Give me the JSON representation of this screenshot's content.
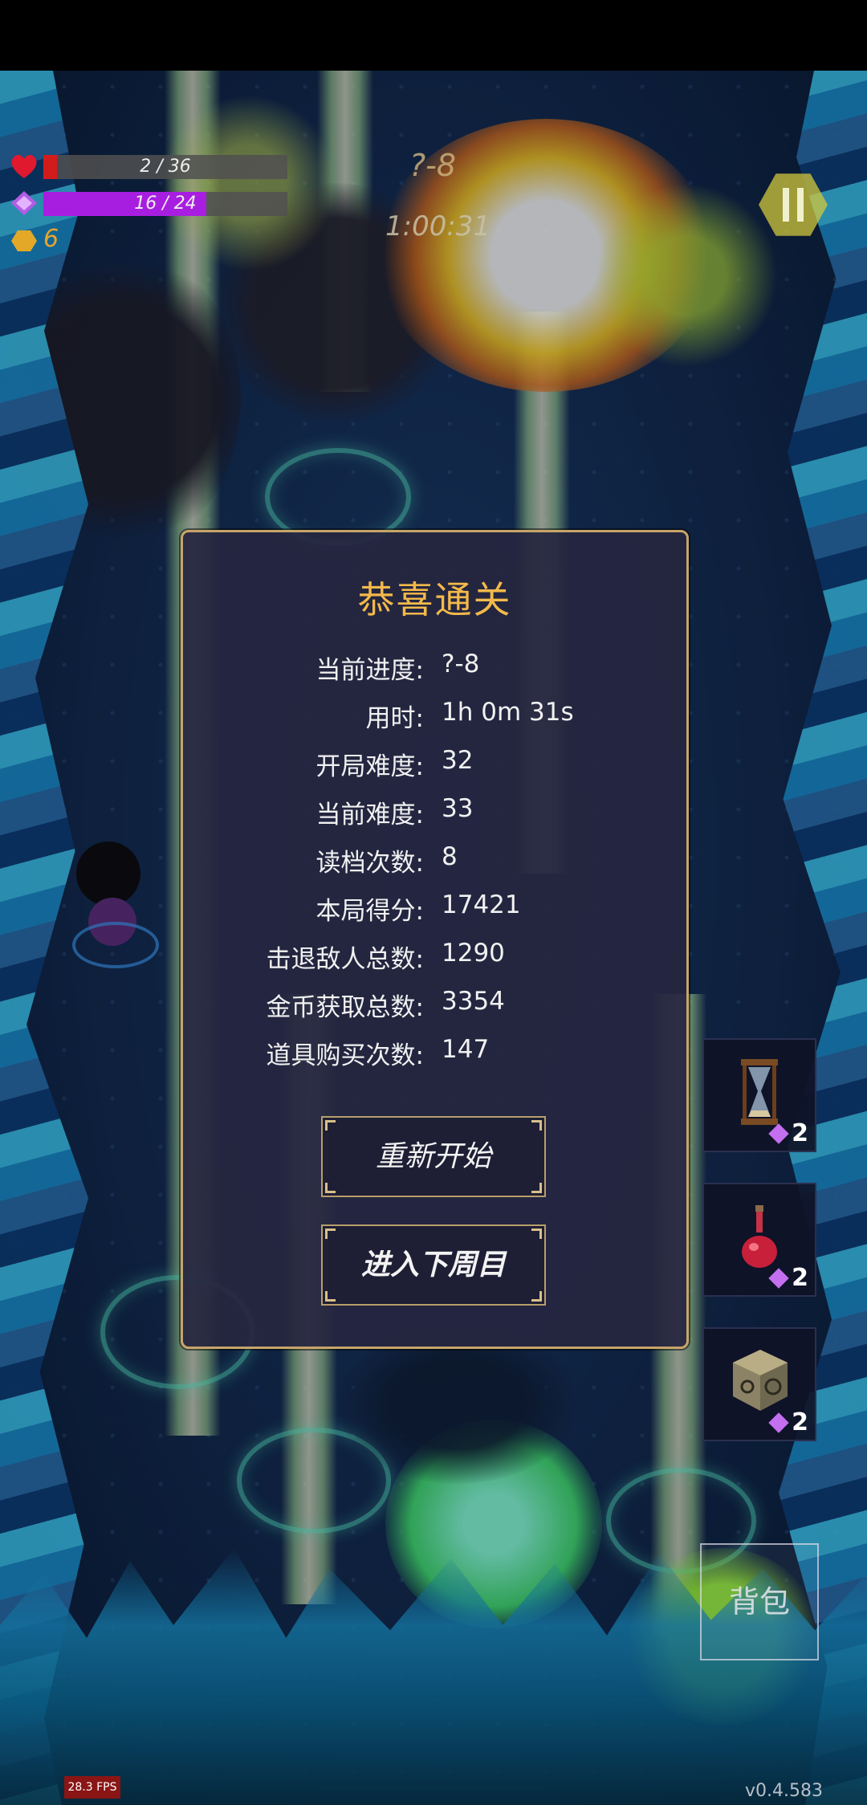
{
  "hud": {
    "hp": {
      "text": "2 / 36",
      "current": 2,
      "max": 36
    },
    "mana": {
      "text": "16 / 24",
      "current": 16,
      "max": 24
    },
    "gold": "6",
    "level": "?-8",
    "timer": "1:00:31"
  },
  "dialog": {
    "title": "恭喜通关",
    "stats": [
      {
        "label": "当前进度:",
        "value": "?-8"
      },
      {
        "label": "用时:",
        "value": "1h 0m 31s"
      },
      {
        "label": "开局难度:",
        "value": "32"
      },
      {
        "label": "当前难度:",
        "value": "33"
      },
      {
        "label": "读档次数:",
        "value": "8"
      },
      {
        "label": "本局得分:",
        "value": "17421"
      },
      {
        "label": "击退敌人总数:",
        "value": "1290"
      },
      {
        "label": "金币获取总数:",
        "value": "3354"
      },
      {
        "label": "道具购买次数:",
        "value": "147"
      }
    ],
    "restart_label": "重新开始",
    "next_cycle_label": "进入下周目"
  },
  "items": [
    {
      "icon": "hourglass-icon",
      "count": "2"
    },
    {
      "icon": "red-potion-icon",
      "count": "2"
    },
    {
      "icon": "rune-cube-icon",
      "count": "2"
    }
  ],
  "bag_label": "背包",
  "fps": "28.3 FPS",
  "version": "v0.4.583",
  "colors": {
    "title": "#f3b94a",
    "gold": "#e7a52b",
    "hp": "#d11c1c",
    "mana": "#a81ee0",
    "frame": "#c7a56a"
  }
}
